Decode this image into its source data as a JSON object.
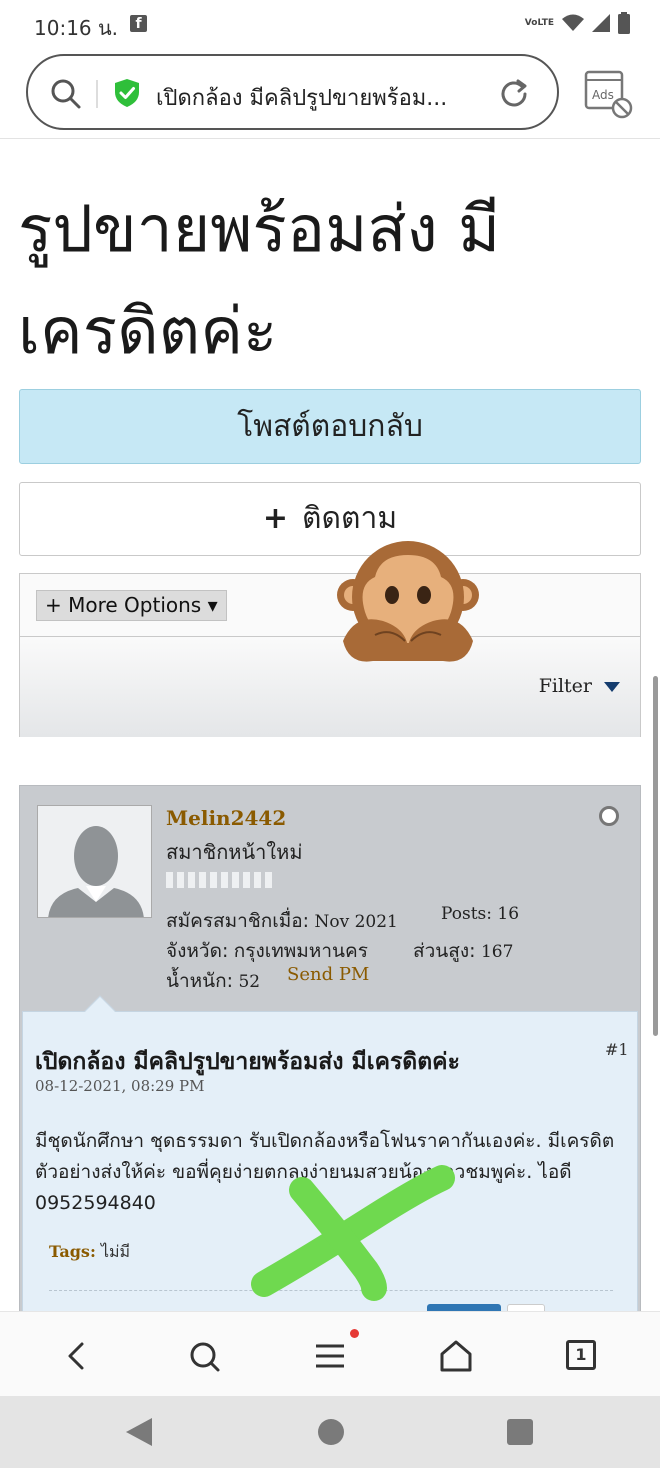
{
  "status_bar": {
    "time": "10:16 น.",
    "fb_badge": "f",
    "network_label": "VoLTE"
  },
  "url_bar": {
    "text": "เปิดกล้อง มีคลิปรูปขายพร้อม...",
    "ads_label": "Ads"
  },
  "page": {
    "title": "รูปขายพร้อมส่ง มีเครดิตค่ะ",
    "reply_button": "โพสต์ตอบกลับ",
    "follow_plus": "+",
    "follow_button": "ติดตาม",
    "more_options": "+ More Options ▾",
    "filter": "Filter"
  },
  "post": {
    "username": "Melin2442",
    "user_title": "สมาชิกหน้าใหม่",
    "join_label": "สมัครสมาชิกเมื่อ:",
    "join_value": "Nov 2021",
    "posts_label": "Posts:",
    "posts_value": "16",
    "province_label": "จังหวัด:",
    "province_value": "กรุงเทพมหานคร",
    "height_label": "ส่วนสูง:",
    "height_value": "167",
    "weight_label": "น้ำหนัก:",
    "weight_value": "52",
    "send_pm": "Send PM",
    "number": "#1",
    "title": "เปิดกล้อง มีคลิปรูปขายพร้อมส่ง มีเครดิตค่ะ",
    "date": "08-12-2021, 08:29 PM",
    "body": "มีชุดนักศึกษา ชุดธรรมดา รับเปิดกล้องหรือโฟนราคากันเองค่ะ. มีเครดิตตัวอย่างส่งให้ค่ะ ขอพี่คุยง่ายตกลงง่ายนมสวยน้องสาวชมพูค่ะ. ไอดี 0952594840",
    "tags_label": "Tags:",
    "tags_value": "ไม่มี"
  },
  "nav": {
    "tab_count": "1"
  },
  "colors": {
    "accent_gold": "#8a5a00",
    "reply_bg": "#c6e8f5",
    "post_bg": "#e4eff8",
    "mark_green": "#6fd94f"
  },
  "icons": [
    "search-icon",
    "shield-check-icon",
    "reload-icon",
    "ads-block-icon",
    "see-no-evil-monkey-icon",
    "back-icon",
    "menu-icon",
    "home-icon",
    "tabs-icon"
  ]
}
